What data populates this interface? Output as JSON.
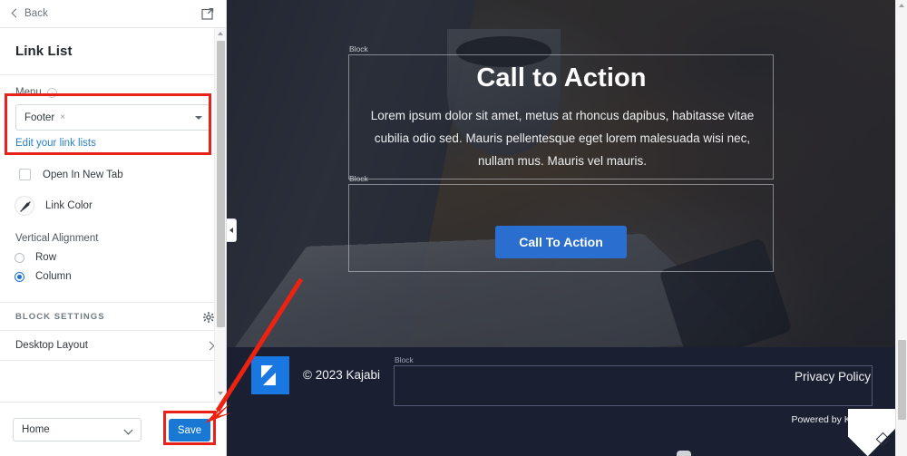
{
  "topbar": {
    "back_label": "Back",
    "back_icon": "chevron-left-icon",
    "external_icon": "external-link-icon"
  },
  "panel": {
    "title": "Link List",
    "menu": {
      "label": "Menu",
      "info_icon": "info-icon",
      "selected_value": "Footer",
      "remove_token": "×",
      "caret_icon": "chevron-down-icon"
    },
    "edit_link": "Edit your link lists",
    "open_new_tab": {
      "label": "Open In New Tab",
      "checked": false
    },
    "link_color": {
      "label": "Link Color",
      "swatch_icon": "no-color-icon"
    },
    "vertical_alignment": {
      "label": "Vertical Alignment",
      "options": [
        {
          "label": "Row",
          "selected": false
        },
        {
          "label": "Column",
          "selected": true
        }
      ]
    },
    "block_settings": {
      "label": "BLOCK SETTINGS",
      "gear_icon": "gear-icon"
    },
    "desktop_layout": {
      "label": "Desktop Layout",
      "chevron_icon": "chevron-right-icon"
    }
  },
  "savebar": {
    "page_select_value": "Home",
    "page_select_caret": "chevron-down-icon",
    "save_label": "Save"
  },
  "preview": {
    "block_label_top": "Block",
    "block_label_mid": "Block",
    "block_label_footer": "Block",
    "hero": {
      "title": "Call to Action",
      "body": "Lorem ipsum dolor sit amet, metus at rhoncus dapibus, habitasse vitae cubilia odio sed. Mauris pellentesque eget lorem malesuada wisi nec, nullam mus. Mauris vel mauris.",
      "button_label": "Call To Action"
    },
    "footer": {
      "logo_icon": "kajabi-logo-icon",
      "copyright": "© 2023 Kajabi",
      "privacy_policy": "Privacy Policy",
      "powered_by": "Powered by Kajabi"
    },
    "collapse_icon": "collapse-panel-icon",
    "resize_icon": "resize-handle-icon"
  },
  "annotations": {
    "highlight_menu": "red-highlight-box",
    "highlight_save": "red-highlight-box",
    "arrow": "red-arrow"
  },
  "colors": {
    "accent_blue": "#1878d4",
    "cta_blue": "#2a6fd0",
    "link_blue": "#2a7fc9",
    "annotation_red": "#e8211b",
    "footer_dark": "#1a2032"
  }
}
